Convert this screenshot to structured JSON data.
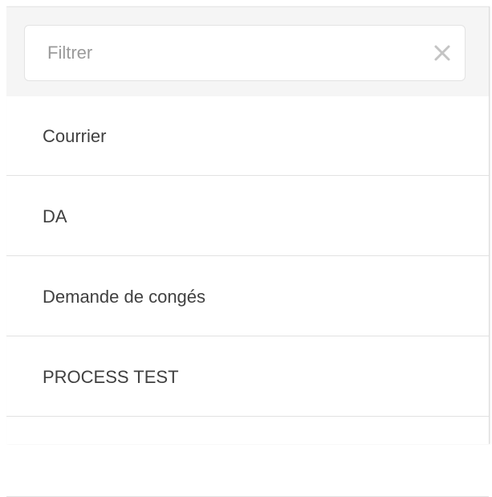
{
  "filter": {
    "placeholder": "Filtrer",
    "value": "",
    "clear_icon": "close-icon"
  },
  "items": [
    {
      "label": "Courrier"
    },
    {
      "label": "DA"
    },
    {
      "label": "Demande de congés"
    },
    {
      "label": "PROCESS TEST"
    },
    {
      "label": ""
    }
  ],
  "colors": {
    "filter_bar_bg": "#f5f5f5",
    "text": "#404040",
    "placeholder": "#9a9a9a",
    "divider": "#e2e2e2"
  }
}
